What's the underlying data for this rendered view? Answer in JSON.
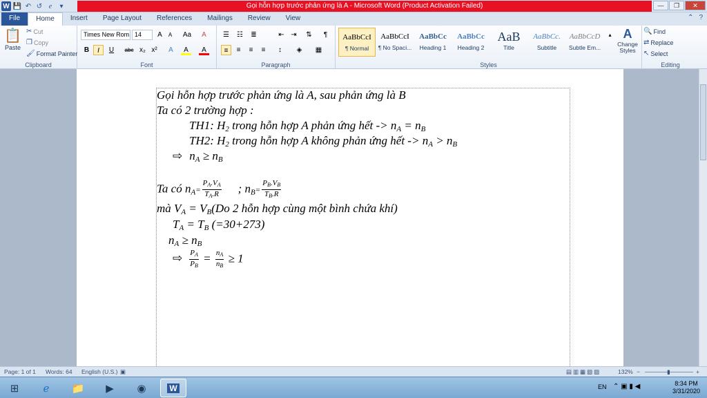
{
  "window": {
    "title": "Gọi hỗn hợp trước phản ứng là A  -  Microsoft Word (Product Activation Failed)",
    "minimize": "—",
    "restore": "❐",
    "close": "✕"
  },
  "qat": {
    "logo": "W",
    "save": "💾",
    "undo": "↶",
    "redo": "↺",
    "formula": "e",
    "more": "▾"
  },
  "tabs": [
    "File",
    "Home",
    "Insert",
    "Page Layout",
    "References",
    "Mailings",
    "Review",
    "View"
  ],
  "clipboard": {
    "paste": "Paste",
    "cut": "Cut",
    "copy": "Copy",
    "format_painter": "Format Painter",
    "label": "Clipboard"
  },
  "font": {
    "name": "Times New Rom",
    "size": "14",
    "label": "Font",
    "bold": "B",
    "italic": "I",
    "underline": "U",
    "strike": "abc",
    "sub": "x₂",
    "sup": "x²",
    "grow": "A",
    "shrink": "A",
    "case": "Aa",
    "clear": "A",
    "highlight": "A",
    "color": "A"
  },
  "paragraph": {
    "label": "Paragraph",
    "pilcrow": "¶"
  },
  "styles": {
    "label": "Styles",
    "change": "Change Styles",
    "items": [
      {
        "preview": "AaBbCcI",
        "name": "¶ Normal"
      },
      {
        "preview": "AaBbCcI",
        "name": "¶ No Spaci..."
      },
      {
        "preview": "AaBbCc",
        "name": "Heading 1"
      },
      {
        "preview": "AaBbCc",
        "name": "Heading 2"
      },
      {
        "preview": "AaB",
        "name": "Title"
      },
      {
        "preview": "AaBbCc.",
        "name": "Subtitle"
      },
      {
        "preview": "AaBbCcD",
        "name": "Subtle Em..."
      }
    ]
  },
  "editing": {
    "find": "Find",
    "replace": "Replace",
    "select": "Select",
    "label": "Editing"
  },
  "doc": {
    "l1": "Gọi hỗn hợp trước phản ứng là A, sau phản ứng là B",
    "l2": "Ta có 2 trường hợp :",
    "l3a": "TH1: H",
    "l3sub": "2",
    "l3b": " trong hỗn hợp A phản ứng hết -> n",
    "l3c": " = n",
    "l4a": "TH2: H",
    "l4sub": "2",
    "l4b": " trong hỗn hợp A không phản ứng hết -> n",
    "l4c": " > n",
    "arrow": "⇨",
    "l5a": "n",
    "l5b": " ≥ n",
    "subA": "A",
    "subB": "B",
    "l6a": "Ta có n",
    "l6eq": "=",
    "l6sep": "; n",
    "fracA_num": "P",
    "fracA_num2": ".V",
    "fracA_den": "T",
    "fracA_den2": ".R",
    "l7": "mà V",
    "l7b": " = V",
    "l7c": "(Do 2 hỗn hợp cùng một bình chứa khí)",
    "l8": "T",
    "l8b": " = T",
    "l8c": " (=30+273)",
    "l9": "n",
    "l9b": " ≥ n",
    "l10n": "P",
    "l10m": " = ",
    "l10n2": "n",
    "l10end": " ≥ 1"
  },
  "status": {
    "page": "Page: 1 of 1",
    "words": "Words: 64",
    "lang": "English (U.S.)",
    "zoom": "132%",
    "minus": "−",
    "plus": "+"
  },
  "taskbar": {
    "lang": "EN",
    "time": "8:34 PM",
    "date": "3/31/2020"
  }
}
